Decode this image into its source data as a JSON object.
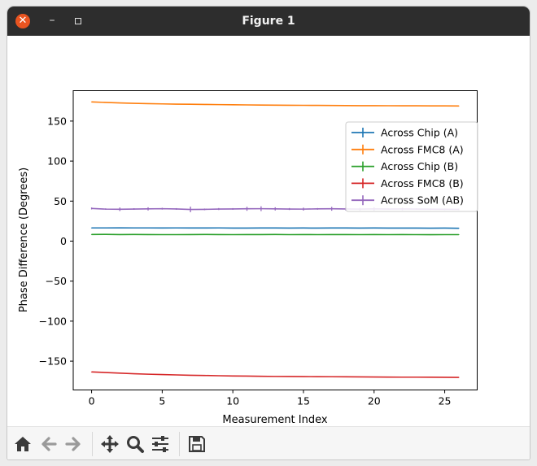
{
  "window": {
    "title": "Figure 1"
  },
  "toolbar": {
    "buttons": [
      "home-icon",
      "back-arrow-icon",
      "forward-arrow-icon",
      "pan-icon",
      "zoom-icon",
      "configure-subplots-icon",
      "save-icon"
    ]
  },
  "colors": {
    "blue": "#1f77b4",
    "orange": "#ff7f0e",
    "green": "#2ca02c",
    "red": "#d62728",
    "purple": "#9467bd"
  },
  "chart_data": {
    "type": "line",
    "title": "",
    "xlabel": "Measurement Index",
    "ylabel": "Phase Difference (Degrees)",
    "xlim": [
      -1.3,
      27.3
    ],
    "ylim": [
      -186,
      188
    ],
    "xticks": [
      0,
      5,
      10,
      15,
      20,
      25
    ],
    "yticks": [
      -150,
      -100,
      -50,
      0,
      50,
      100,
      150
    ],
    "xtick_labels": [
      "0",
      "5",
      "10",
      "15",
      "20",
      "25"
    ],
    "ytick_labels": [
      "−150",
      "−100",
      "−50",
      "0",
      "50",
      "100",
      "150"
    ],
    "legend_position": "top-right",
    "x": [
      0,
      1,
      2,
      3,
      4,
      5,
      6,
      7,
      8,
      9,
      10,
      11,
      12,
      13,
      14,
      15,
      16,
      17,
      18,
      19,
      20,
      21,
      22,
      23,
      24,
      25,
      26
    ],
    "series": [
      {
        "name": "Across Chip (A)",
        "color": "#1f77b4",
        "values": [
          16.5,
          16.5,
          16.6,
          16.5,
          16.5,
          16.4,
          16.5,
          16.4,
          16.4,
          16.5,
          16.3,
          16.3,
          16.4,
          16.4,
          16.3,
          16.4,
          16.3,
          16.4,
          16.4,
          16.3,
          16.4,
          16.3,
          16.3,
          16.3,
          16.2,
          16.3,
          16.1
        ],
        "errors": [
          0.4,
          0.4,
          0.4,
          0.4,
          0.4,
          0.4,
          0.4,
          0.4,
          0.4,
          0.4,
          0.4,
          0.4,
          0.4,
          0.4,
          0.4,
          0.4,
          0.4,
          0.4,
          0.4,
          0.4,
          0.4,
          0.4,
          0.4,
          0.4,
          0.4,
          0.4,
          0.4
        ]
      },
      {
        "name": "Across FMC8 (A)",
        "color": "#ff7f0e",
        "values": [
          174,
          173.3,
          172.7,
          172.2,
          171.8,
          171.5,
          171.2,
          171,
          170.8,
          170.6,
          170.4,
          170.2,
          170,
          169.9,
          169.8,
          169.7,
          169.6,
          169.5,
          169.4,
          169.3,
          169.3,
          169.2,
          169.1,
          169.1,
          169,
          169,
          168.9
        ],
        "errors": [
          0.4,
          0.4,
          0.4,
          0.4,
          0.4,
          0.4,
          0.4,
          0.4,
          0.4,
          0.4,
          0.4,
          0.4,
          0.4,
          0.4,
          0.4,
          0.4,
          0.4,
          0.4,
          0.4,
          0.4,
          0.4,
          0.4,
          0.4,
          0.4,
          0.4,
          0.4,
          0.4
        ]
      },
      {
        "name": "Across Chip (B)",
        "color": "#2ca02c",
        "values": [
          8.3,
          8.4,
          8.2,
          8.3,
          8.2,
          8.1,
          8.1,
          8.2,
          8.3,
          8.2,
          8.1,
          8.2,
          8.2,
          8.3,
          8.1,
          8.2,
          8.1,
          8.2,
          8.2,
          8.1,
          8.2,
          8.1,
          8.2,
          8.1,
          8.0,
          8.1,
          8.1
        ],
        "errors": [
          0.4,
          0.4,
          0.4,
          0.4,
          0.4,
          0.4,
          0.4,
          0.4,
          0.4,
          0.4,
          0.4,
          0.4,
          0.4,
          0.4,
          0.4,
          0.4,
          0.4,
          0.4,
          0.4,
          0.4,
          0.4,
          0.4,
          0.4,
          0.4,
          0.4,
          0.4,
          0.4
        ]
      },
      {
        "name": "Across FMC8 (B)",
        "color": "#d62728",
        "values": [
          -163.5,
          -164.2,
          -165,
          -165.7,
          -166.3,
          -166.8,
          -167.2,
          -167.6,
          -167.9,
          -168.2,
          -168.5,
          -168.7,
          -168.9,
          -169.1,
          -169.2,
          -169.3,
          -169.4,
          -169.5,
          -169.6,
          -169.7,
          -169.8,
          -169.9,
          -170,
          -170,
          -170.1,
          -170.2,
          -170.3
        ],
        "errors": [
          0.4,
          0.4,
          0.4,
          0.4,
          0.4,
          0.4,
          0.4,
          0.4,
          0.4,
          0.4,
          0.4,
          0.4,
          0.4,
          0.4,
          0.4,
          0.4,
          0.4,
          0.4,
          0.4,
          0.4,
          0.4,
          0.4,
          0.4,
          0.4,
          0.4,
          0.4,
          0.4
        ]
      },
      {
        "name": "Across SoM (AB)",
        "color": "#9467bd",
        "values": [
          40.8,
          40,
          39.8,
          40.1,
          40.3,
          40.5,
          40.2,
          39.6,
          39.7,
          40.1,
          40.2,
          40.4,
          40.5,
          40.3,
          40.1,
          40,
          40.3,
          40.4,
          40.2,
          40,
          40.3,
          40.1,
          40.2,
          40.1,
          39.9,
          39.8,
          39.7
        ],
        "errors": [
          1.2,
          0.9,
          2.2,
          1.0,
          2.0,
          1.1,
          1.0,
          3.5,
          1.0,
          1.2,
          1.0,
          2.5,
          3.0,
          2.0,
          1.2,
          1.8,
          1.0,
          2.4,
          2.0,
          1.6,
          2.1,
          1.0,
          1.6,
          1.0,
          0.9,
          1.0,
          1.0
        ]
      }
    ]
  }
}
